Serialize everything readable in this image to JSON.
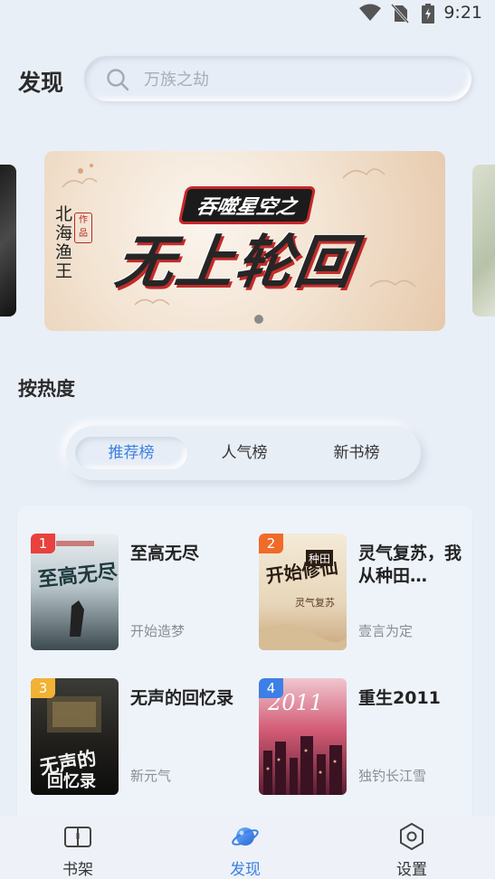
{
  "status": {
    "time": "9:21"
  },
  "header": {
    "title": "发现",
    "search_placeholder": "万族之劫"
  },
  "banner": {
    "author": "北海渔王",
    "seal_text": "作品",
    "subtitle": "吞噬星空之",
    "title": "无上轮回"
  },
  "section": {
    "title": "按热度"
  },
  "tabs": [
    {
      "label": "推荐榜",
      "active": true
    },
    {
      "label": "人气榜",
      "active": false
    },
    {
      "label": "新书榜",
      "active": false
    }
  ],
  "books": [
    {
      "rank": "1",
      "rank_color": "#e8413e",
      "title": "至高无尽",
      "author": "开始造梦"
    },
    {
      "rank": "2",
      "rank_color": "#f06a2a",
      "title": "灵气复苏，我从种田…",
      "author": "壹言为定"
    },
    {
      "rank": "3",
      "rank_color": "#f2b233",
      "title": "无声的回忆录",
      "author": "新元气"
    },
    {
      "rank": "4",
      "rank_color": "#3d7fe6",
      "title": "重生2011",
      "author": "独钓长江雪"
    }
  ],
  "nav": [
    {
      "label": "书架",
      "icon": "book-icon",
      "active": false
    },
    {
      "label": "发现",
      "icon": "planet-icon",
      "active": true
    },
    {
      "label": "设置",
      "icon": "settings-icon",
      "active": false
    }
  ],
  "colors": {
    "accent": "#3b7fe0",
    "background": "#e9eff7"
  }
}
